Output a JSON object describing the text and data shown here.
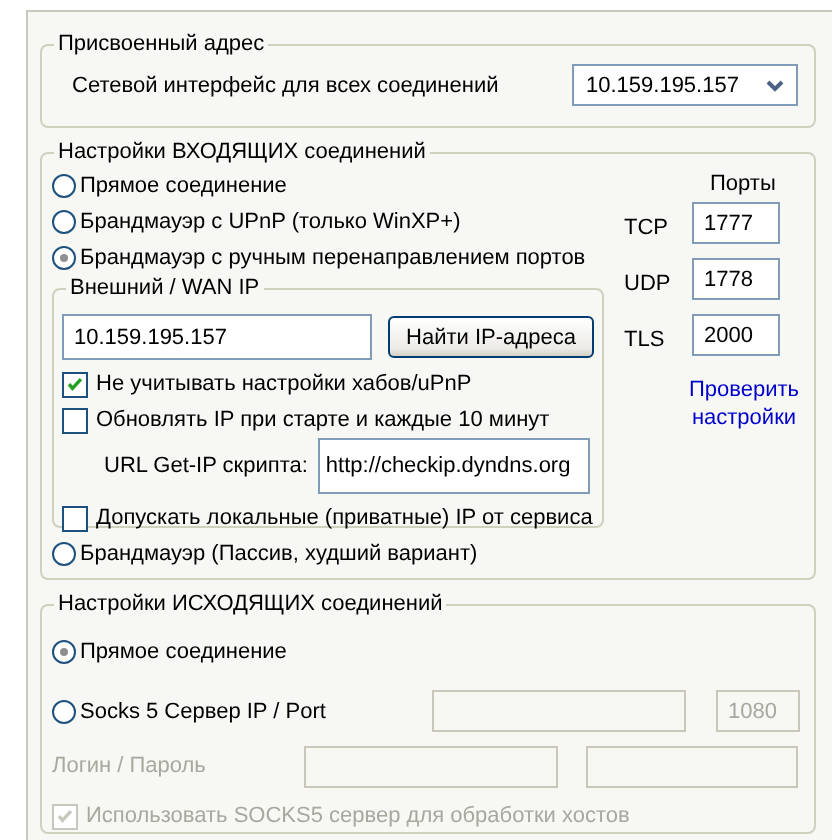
{
  "assigned_address": {
    "legend": "Присвоенный адрес",
    "label": "Сетевой интерфейс для всех соединений",
    "interface": "10.159.195.157"
  },
  "incoming": {
    "legend": "Настройки ВХОДЯЩИХ соединений",
    "modes": [
      {
        "label": "Прямое соединение",
        "selected": false
      },
      {
        "label": "Брандмауэр с UPnP (только WinXP+)",
        "selected": false
      },
      {
        "label": "Брандмауэр с ручным перенаправлением портов",
        "selected": true
      },
      {
        "label": "Брандмауэр (Пассив, худший вариант)",
        "selected": false
      }
    ],
    "ports_heading": "Порты",
    "ports": [
      {
        "label": "TCP",
        "value": "1777"
      },
      {
        "label": "UDP",
        "value": "1778"
      },
      {
        "label": "TLS",
        "value": "2000"
      }
    ],
    "check_link": "Проверить настройки",
    "wan": {
      "legend": "Внешний / WAN IP",
      "ip": "10.159.195.157",
      "find_button": "Найти IP-адреса",
      "options": [
        {
          "label": "Не учитывать настройки хабов/uPnP",
          "checked": true
        },
        {
          "label": "Обновлять IP при старте и каждые 10 минут",
          "checked": false
        }
      ],
      "url_label": "URL Get-IP скрипта:",
      "url": "http://checkip.dyndns.org",
      "allow_local": {
        "label": "Допускать локальные (приватные) IP от сервиса",
        "checked": false
      }
    }
  },
  "outgoing": {
    "legend": "Настройки ИСХОДЯЩИХ соединений",
    "modes": [
      {
        "label": "Прямое соединение",
        "selected": true
      },
      {
        "label": "Socks 5 Сервер IP / Port",
        "selected": false
      }
    ],
    "socks_port": "1080",
    "login_label": "Логин / Пароль",
    "fields_disabled": true,
    "use_socks": {
      "label": "Использовать SOCKS5 сервер для обработки хостов",
      "checked": true,
      "disabled": true
    }
  }
}
